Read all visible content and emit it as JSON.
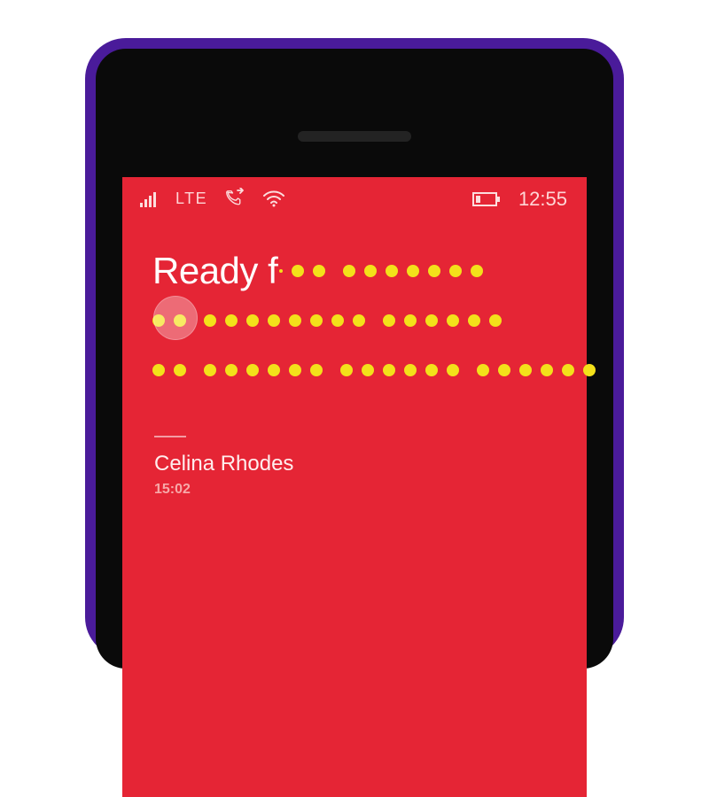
{
  "status": {
    "network_label": "LTE",
    "clock": "12:55"
  },
  "hero": {
    "revealed_text": "Ready f",
    "obscured_lines": [
      {
        "prefix_dots_after_text": 1,
        "words": [
          2,
          7
        ]
      },
      {
        "words": [
          2,
          8,
          6
        ]
      },
      {
        "words": [
          2,
          6,
          6,
          6
        ]
      }
    ]
  },
  "article": {
    "author": "Celina Rhodes",
    "timestamp": "15:02"
  },
  "colors": {
    "accent": "#e52535",
    "dot": "#f3e11a"
  }
}
